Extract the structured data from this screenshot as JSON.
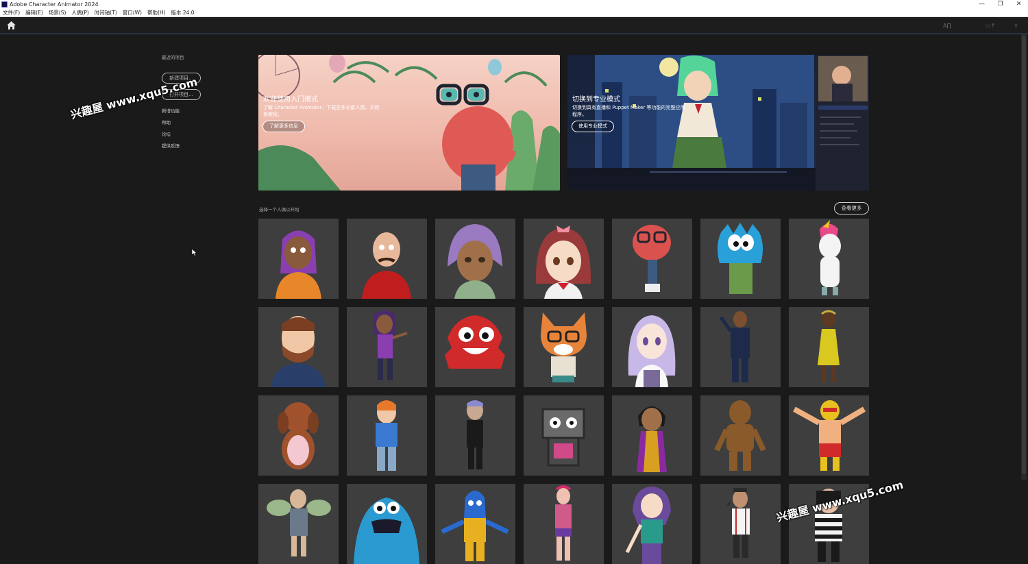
{
  "window": {
    "title": "Adobe Character Animator 2024",
    "controls": [
      "—",
      "❐",
      "✕"
    ]
  },
  "menu": [
    "文件(F)",
    "编辑(E)",
    "场景(S)",
    "人偶(P)",
    "时间轴(T)",
    "窗口(W)",
    "帮助(H)",
    "版本 24.0"
  ],
  "toolbar": {
    "home_icon": "home-icon",
    "right_items": [
      "A∏",
      "▭↑",
      "⇪"
    ]
  },
  "sidebar": {
    "heading": "最近的项目",
    "buttons": [
      "新建项目...",
      "打开项目..."
    ],
    "links": [
      "新增功能",
      "帮助",
      "论坛",
      "提供反馈"
    ]
  },
  "heroes": [
    {
      "title": "欢迎使用入门模式",
      "description": "了解 Character Animator，下载更多全套人偶，并观看教程。",
      "button": "了解更多信息"
    },
    {
      "title": "切换到专业模式",
      "description": "切换到具有直播和 Puppet Maker 等功能的完整应用程序。",
      "button": "使用专业模式"
    }
  ],
  "puppets_section": {
    "label": "选择一个人偶以开始",
    "more_button": "查看更多"
  },
  "watermarks": [
    "兴趣屋 www.xqu5.com",
    "兴趣屋 www.xqu5.com"
  ],
  "colors": {
    "accent_line": "#2e5a80",
    "tile_bg": "#3e3e3e",
    "app_bg": "#1a1a1a"
  }
}
